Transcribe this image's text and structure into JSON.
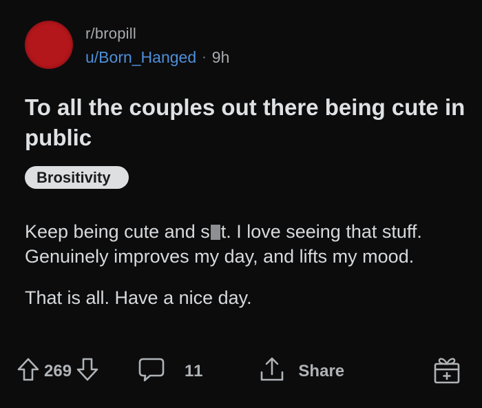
{
  "header": {
    "subreddit": "r/bropill",
    "username": "u/Born_Hanged",
    "separator": "·",
    "time": "9h"
  },
  "post": {
    "title": "To all the couples out there being cute in public",
    "flair": "Brositivity",
    "body": {
      "p1_before": "Keep being cute and s",
      "p1_after": "t. I love seeing that stuff. Genuinely improves my day, and lifts my mood.",
      "p2": "That is all. Have a nice day."
    }
  },
  "actions": {
    "upvotes": "269",
    "comments": "11",
    "share_label": "Share"
  },
  "colors": {
    "background": "#0c0c0d",
    "username": "#4f8fd8",
    "avatar": "#b3161b",
    "flair_bg": "#dedfe0"
  },
  "icons": [
    "upvote-icon",
    "downvote-icon",
    "comment-icon",
    "share-icon",
    "gift-icon"
  ]
}
